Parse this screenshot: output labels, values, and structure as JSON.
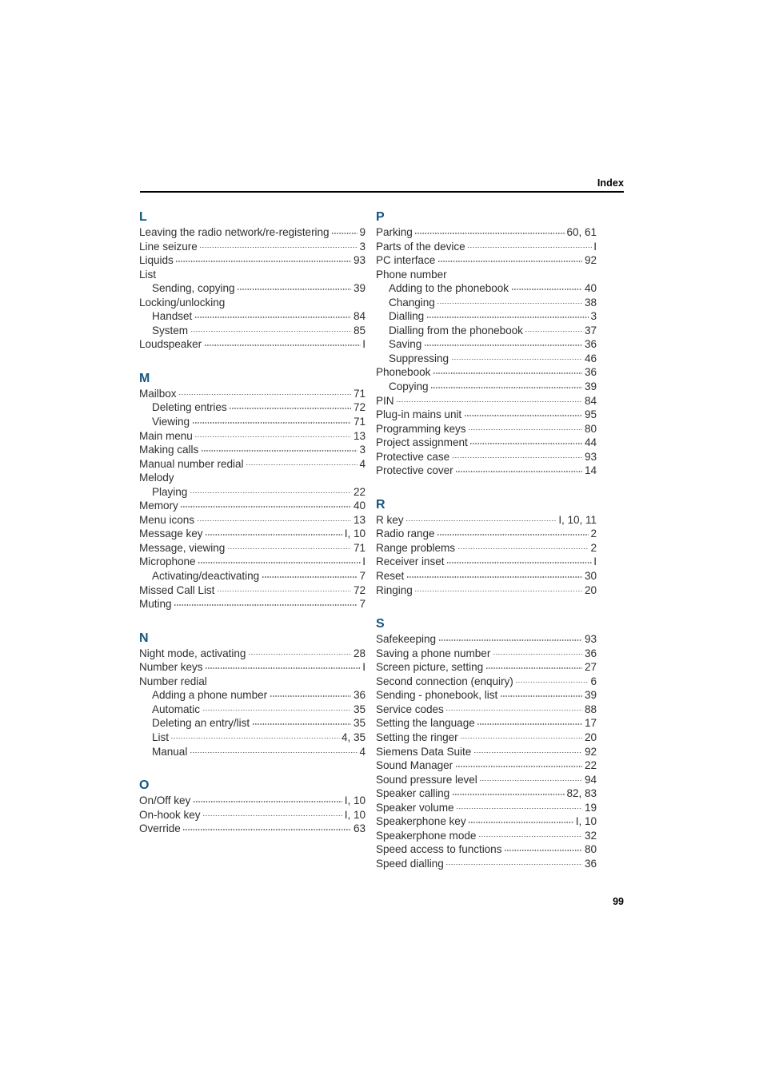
{
  "header": {
    "title": "Index"
  },
  "folio": {
    "page_number": "99"
  },
  "colors": {
    "section_letter": "#16567f",
    "body_text": "#2f2f2f",
    "rule": "#000000"
  },
  "columns": {
    "left": [
      {
        "letter": "L",
        "entries": [
          {
            "label": "Leaving the radio network/re-registering",
            "page": "9",
            "sub": false
          },
          {
            "label": "Line seizure",
            "page": "3",
            "sub": false
          },
          {
            "label": "Liquids",
            "page": "93",
            "sub": false
          },
          {
            "label": "List",
            "page": "",
            "sub": false
          },
          {
            "label": "Sending, copying",
            "page": "39",
            "sub": true
          },
          {
            "label": "Locking/unlocking",
            "page": "",
            "sub": false
          },
          {
            "label": "Handset",
            "page": "84",
            "sub": true
          },
          {
            "label": "System",
            "page": "85",
            "sub": true
          },
          {
            "label": "Loudspeaker",
            "page": "I",
            "sub": false
          }
        ]
      },
      {
        "letter": "M",
        "entries": [
          {
            "label": "Mailbox",
            "page": "71",
            "sub": false
          },
          {
            "label": "Deleting entries",
            "page": "72",
            "sub": true
          },
          {
            "label": "Viewing",
            "page": "71",
            "sub": true
          },
          {
            "label": "Main menu",
            "page": "13",
            "sub": false
          },
          {
            "label": "Making calls",
            "page": "3",
            "sub": false
          },
          {
            "label": "Manual number redial",
            "page": "4",
            "sub": false
          },
          {
            "label": "Melody",
            "page": "",
            "sub": false
          },
          {
            "label": "Playing",
            "page": "22",
            "sub": true
          },
          {
            "label": "Memory",
            "page": "40",
            "sub": false
          },
          {
            "label": "Menu icons",
            "page": "13",
            "sub": false
          },
          {
            "label": "Message key",
            "page": "I, 10",
            "sub": false
          },
          {
            "label": "Message, viewing",
            "page": "71",
            "sub": false
          },
          {
            "label": "Microphone",
            "page": "I",
            "sub": false
          },
          {
            "label": "Activating/deactivating",
            "page": "7",
            "sub": true
          },
          {
            "label": "Missed Call List",
            "page": "72",
            "sub": false
          },
          {
            "label": "Muting",
            "page": "7",
            "sub": false
          }
        ]
      },
      {
        "letter": "N",
        "entries": [
          {
            "label": "Night mode, activating",
            "page": "28",
            "sub": false
          },
          {
            "label": "Number keys",
            "page": "I",
            "sub": false
          },
          {
            "label": "Number redial",
            "page": "",
            "sub": false
          },
          {
            "label": "Adding a phone number",
            "page": "36",
            "sub": true
          },
          {
            "label": "Automatic",
            "page": "35",
            "sub": true
          },
          {
            "label": "Deleting an entry/list",
            "page": "35",
            "sub": true
          },
          {
            "label": "List",
            "page": "4, 35",
            "sub": true
          },
          {
            "label": "Manual",
            "page": "4",
            "sub": true
          }
        ]
      },
      {
        "letter": "O",
        "entries": [
          {
            "label": "On/Off key",
            "page": "I, 10",
            "sub": false
          },
          {
            "label": "On-hook key",
            "page": "I, 10",
            "sub": false
          },
          {
            "label": "Override",
            "page": "63",
            "sub": false
          }
        ]
      }
    ],
    "right": [
      {
        "letter": "P",
        "entries": [
          {
            "label": "Parking",
            "page": "60, 61",
            "sub": false
          },
          {
            "label": "Parts of the device",
            "page": "I",
            "sub": false
          },
          {
            "label": "PC interface",
            "page": "92",
            "sub": false
          },
          {
            "label": "Phone number",
            "page": "",
            "sub": false
          },
          {
            "label": "Adding to the phonebook",
            "page": "40",
            "sub": true
          },
          {
            "label": "Changing",
            "page": "38",
            "sub": true
          },
          {
            "label": "Dialling",
            "page": "3",
            "sub": true
          },
          {
            "label": "Dialling from the phonebook",
            "page": "37",
            "sub": true
          },
          {
            "label": "Saving",
            "page": "36",
            "sub": true
          },
          {
            "label": "Suppressing",
            "page": "46",
            "sub": true
          },
          {
            "label": "Phonebook",
            "page": "36",
            "sub": false
          },
          {
            "label": "Copying",
            "page": "39",
            "sub": true
          },
          {
            "label": "PIN",
            "page": "84",
            "sub": false
          },
          {
            "label": "Plug-in mains unit",
            "page": "95",
            "sub": false
          },
          {
            "label": "Programming keys",
            "page": "80",
            "sub": false
          },
          {
            "label": "Project assignment",
            "page": "44",
            "sub": false
          },
          {
            "label": "Protective case",
            "page": "93",
            "sub": false
          },
          {
            "label": "Protective cover",
            "page": "14",
            "sub": false
          }
        ]
      },
      {
        "letter": "R",
        "entries": [
          {
            "label": "R key",
            "page": "I, 10, 11",
            "sub": false
          },
          {
            "label": "Radio range",
            "page": "2",
            "sub": false
          },
          {
            "label": "Range problems",
            "page": "2",
            "sub": false
          },
          {
            "label": "Receiver inset",
            "page": "I",
            "sub": false
          },
          {
            "label": "Reset",
            "page": "30",
            "sub": false
          },
          {
            "label": "Ringing",
            "page": "20",
            "sub": false
          }
        ]
      },
      {
        "letter": "S",
        "entries": [
          {
            "label": "Safekeeping",
            "page": "93",
            "sub": false
          },
          {
            "label": "Saving a phone number",
            "page": "36",
            "sub": false
          },
          {
            "label": "Screen picture, setting",
            "page": "27",
            "sub": false
          },
          {
            "label": "Second connection (enquiry)",
            "page": "6",
            "sub": false
          },
          {
            "label": "Sending - phonebook, list",
            "page": "39",
            "sub": false
          },
          {
            "label": "Service codes",
            "page": "88",
            "sub": false
          },
          {
            "label": "Setting the language",
            "page": "17",
            "sub": false
          },
          {
            "label": "Setting the ringer",
            "page": "20",
            "sub": false
          },
          {
            "label": "Siemens Data Suite",
            "page": "92",
            "sub": false
          },
          {
            "label": "Sound Manager",
            "page": "22",
            "sub": false
          },
          {
            "label": "Sound pressure level",
            "page": "94",
            "sub": false
          },
          {
            "label": "Speaker calling",
            "page": "82, 83",
            "sub": false
          },
          {
            "label": "Speaker volume",
            "page": "19",
            "sub": false
          },
          {
            "label": "Speakerphone key",
            "page": "I, 10",
            "sub": false
          },
          {
            "label": "Speakerphone mode",
            "page": "32",
            "sub": false
          },
          {
            "label": "Speed access to functions",
            "page": "80",
            "sub": false
          },
          {
            "label": "Speed dialling",
            "page": "36",
            "sub": false
          }
        ]
      }
    ]
  }
}
